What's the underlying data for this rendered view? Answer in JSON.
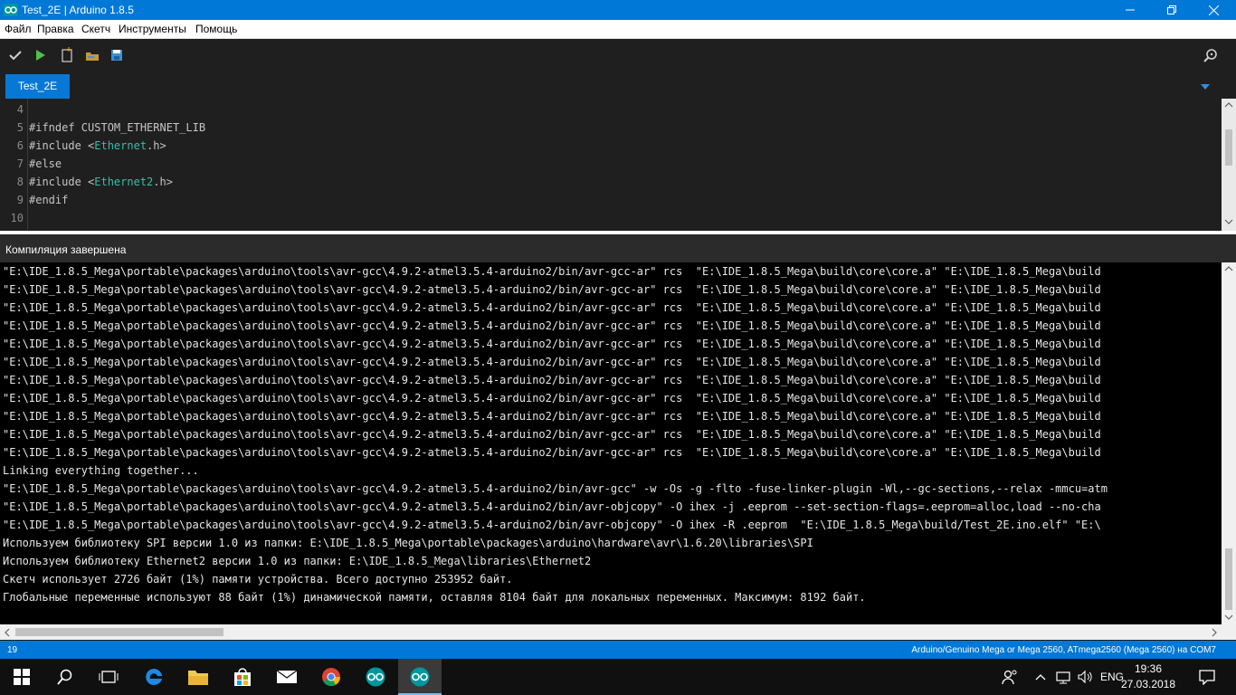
{
  "window": {
    "title": "Test_2E | Arduino 1.8.5",
    "minimize_icon": "minimize-icon",
    "maximize_icon": "restore-icon",
    "close_icon": "close-icon",
    "accent": "#0078d7"
  },
  "menu": {
    "items": [
      "Файл",
      "Правка",
      "Скетч",
      "Инструменты",
      "Помощь"
    ]
  },
  "toolbar": {
    "buttons": [
      "verify-icon",
      "upload-icon",
      "new-icon",
      "open-icon",
      "save-icon"
    ],
    "serial_monitor_icon": "serial-monitor-icon"
  },
  "tabs": {
    "active": "Test_2E"
  },
  "editor": {
    "lines": [
      {
        "num": "4",
        "text": ""
      },
      {
        "num": "5",
        "text": "#ifndef CUSTOM_ETHERNET_LIB"
      },
      {
        "num": "6",
        "pre": "#include <",
        "lib": "Ethernet",
        "post": ".h>"
      },
      {
        "num": "7",
        "text": "#else"
      },
      {
        "num": "8",
        "pre": "#include <",
        "lib": "Ethernet2",
        "post": ".h>"
      },
      {
        "num": "9",
        "text": "#endif"
      },
      {
        "num": "10",
        "text": ""
      }
    ]
  },
  "status": {
    "message": "Компиляция завершена"
  },
  "console": {
    "lines": [
      "\"E:\\IDE_1.8.5_Mega\\portable\\packages\\arduino\\tools\\avr-gcc\\4.9.2-atmel3.5.4-arduino2/bin/avr-gcc-ar\" rcs  \"E:\\IDE_1.8.5_Mega\\build\\core\\core.a\" \"E:\\IDE_1.8.5_Mega\\build",
      "\"E:\\IDE_1.8.5_Mega\\portable\\packages\\arduino\\tools\\avr-gcc\\4.9.2-atmel3.5.4-arduino2/bin/avr-gcc-ar\" rcs  \"E:\\IDE_1.8.5_Mega\\build\\core\\core.a\" \"E:\\IDE_1.8.5_Mega\\build",
      "\"E:\\IDE_1.8.5_Mega\\portable\\packages\\arduino\\tools\\avr-gcc\\4.9.2-atmel3.5.4-arduino2/bin/avr-gcc-ar\" rcs  \"E:\\IDE_1.8.5_Mega\\build\\core\\core.a\" \"E:\\IDE_1.8.5_Mega\\build",
      "\"E:\\IDE_1.8.5_Mega\\portable\\packages\\arduino\\tools\\avr-gcc\\4.9.2-atmel3.5.4-arduino2/bin/avr-gcc-ar\" rcs  \"E:\\IDE_1.8.5_Mega\\build\\core\\core.a\" \"E:\\IDE_1.8.5_Mega\\build",
      "\"E:\\IDE_1.8.5_Mega\\portable\\packages\\arduino\\tools\\avr-gcc\\4.9.2-atmel3.5.4-arduino2/bin/avr-gcc-ar\" rcs  \"E:\\IDE_1.8.5_Mega\\build\\core\\core.a\" \"E:\\IDE_1.8.5_Mega\\build",
      "\"E:\\IDE_1.8.5_Mega\\portable\\packages\\arduino\\tools\\avr-gcc\\4.9.2-atmel3.5.4-arduino2/bin/avr-gcc-ar\" rcs  \"E:\\IDE_1.8.5_Mega\\build\\core\\core.a\" \"E:\\IDE_1.8.5_Mega\\build",
      "\"E:\\IDE_1.8.5_Mega\\portable\\packages\\arduino\\tools\\avr-gcc\\4.9.2-atmel3.5.4-arduino2/bin/avr-gcc-ar\" rcs  \"E:\\IDE_1.8.5_Mega\\build\\core\\core.a\" \"E:\\IDE_1.8.5_Mega\\build",
      "\"E:\\IDE_1.8.5_Mega\\portable\\packages\\arduino\\tools\\avr-gcc\\4.9.2-atmel3.5.4-arduino2/bin/avr-gcc-ar\" rcs  \"E:\\IDE_1.8.5_Mega\\build\\core\\core.a\" \"E:\\IDE_1.8.5_Mega\\build",
      "\"E:\\IDE_1.8.5_Mega\\portable\\packages\\arduino\\tools\\avr-gcc\\4.9.2-atmel3.5.4-arduino2/bin/avr-gcc-ar\" rcs  \"E:\\IDE_1.8.5_Mega\\build\\core\\core.a\" \"E:\\IDE_1.8.5_Mega\\build",
      "\"E:\\IDE_1.8.5_Mega\\portable\\packages\\arduino\\tools\\avr-gcc\\4.9.2-atmel3.5.4-arduino2/bin/avr-gcc-ar\" rcs  \"E:\\IDE_1.8.5_Mega\\build\\core\\core.a\" \"E:\\IDE_1.8.5_Mega\\build",
      "\"E:\\IDE_1.8.5_Mega\\portable\\packages\\arduino\\tools\\avr-gcc\\4.9.2-atmel3.5.4-arduino2/bin/avr-gcc-ar\" rcs  \"E:\\IDE_1.8.5_Mega\\build\\core\\core.a\" \"E:\\IDE_1.8.5_Mega\\build",
      "Linking everything together...",
      "\"E:\\IDE_1.8.5_Mega\\portable\\packages\\arduino\\tools\\avr-gcc\\4.9.2-atmel3.5.4-arduino2/bin/avr-gcc\" -w -Os -g -flto -fuse-linker-plugin -Wl,--gc-sections,--relax -mmcu=atm",
      "\"E:\\IDE_1.8.5_Mega\\portable\\packages\\arduino\\tools\\avr-gcc\\4.9.2-atmel3.5.4-arduino2/bin/avr-objcopy\" -O ihex -j .eeprom --set-section-flags=.eeprom=alloc,load --no-cha",
      "\"E:\\IDE_1.8.5_Mega\\portable\\packages\\arduino\\tools\\avr-gcc\\4.9.2-atmel3.5.4-arduino2/bin/avr-objcopy\" -O ihex -R .eeprom  \"E:\\IDE_1.8.5_Mega\\build/Test_2E.ino.elf\" \"E:\\",
      "Используем библиотеку SPI версии 1.0 из папки: E:\\IDE_1.8.5_Mega\\portable\\packages\\arduino\\hardware\\avr\\1.6.20\\libraries\\SPI",
      "Используем библиотеку Ethernet2 версии 1.0 из папки: E:\\IDE_1.8.5_Mega\\libraries\\Ethernet2",
      "Скетч использует 2726 байт (1%) памяти устройства. Всего доступно 253952 байт.",
      "Глобальные переменные используют 88 байт (1%) динамической памяти, оставляя 8104 байт для локальных переменных. Максимум: 8192 байт."
    ]
  },
  "bottom": {
    "line_number": "19",
    "board": "Arduino/Genuino Mega or Mega 2560, ATmega2560 (Mega 2560) на COM7"
  },
  "taskbar": {
    "apps": [
      "windows-start-icon",
      "search-icon",
      "task-view-icon",
      "edge-icon",
      "file-explorer-icon",
      "store-icon",
      "mail-icon",
      "chrome-icon",
      "arduino-icon",
      "arduino-active-icon"
    ],
    "language": "ENG",
    "time": "19:36",
    "date": "27.03.2018"
  }
}
